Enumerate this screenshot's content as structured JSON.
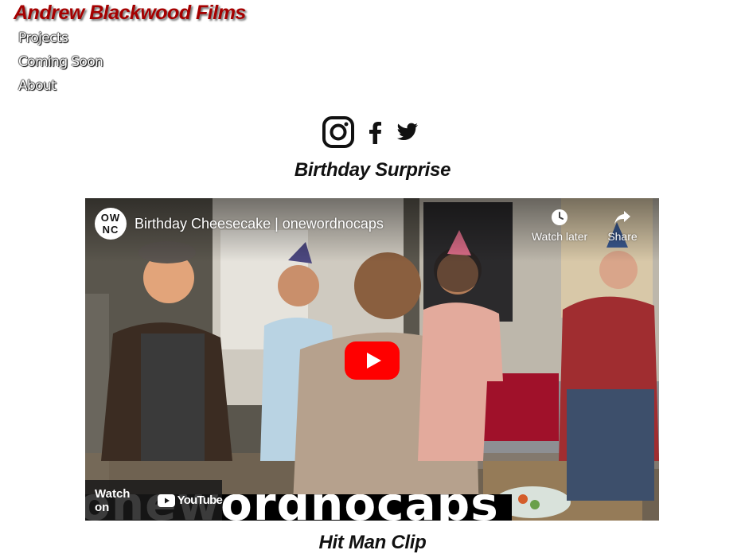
{
  "site": {
    "title": "Andrew Blackwood Films"
  },
  "nav": {
    "items": [
      "Projects",
      "Coming Soon",
      "About"
    ]
  },
  "social": {
    "icons": [
      "instagram-icon",
      "facebook-icon",
      "twitter-icon"
    ]
  },
  "projects": [
    {
      "title": "Birthday Surprise",
      "video": {
        "channel_logo": "OW NC",
        "title": "Birthday Cheesecake | onewordnocaps",
        "watch_later_label": "Watch later",
        "share_label": "Share",
        "watch_on_label": "Watch on",
        "youtube_label": "YouTube",
        "banner_text": "onewordnocaps"
      }
    },
    {
      "title": "Hit Man Clip"
    }
  ],
  "colors": {
    "title": "#a50000",
    "play": "#ff0000",
    "nav_text": "#ffffff"
  }
}
